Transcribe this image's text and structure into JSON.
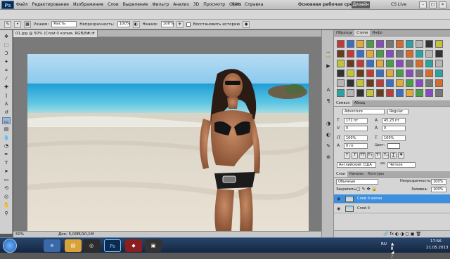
{
  "app": {
    "logo": "Ps",
    "menu": [
      "Файл",
      "Редактирование",
      "Изображение",
      "Слои",
      "Выделение",
      "Фильтр",
      "Анализ",
      "3D",
      "Просмотр",
      "Окно",
      "Справка"
    ],
    "zoom_menu": "50%",
    "workspace": "Основная рабочая среда",
    "design_button": "Дизайн",
    "cslive": "CS Live",
    "window_buttons": [
      "–",
      "□",
      "×"
    ]
  },
  "options": {
    "mode_label": "Режим:",
    "mode_value": "Кисть",
    "opacity_label": "Непрозрачность:",
    "opacity_value": "100%",
    "pressure_label": "Нажим:",
    "pressure_value": "100%",
    "restore_label": "Восстановить историю"
  },
  "document": {
    "tab_title": "01.jpg @ 50% (Слой 0 копия, RGB/8#) *",
    "zoom": "50%",
    "doc_info": "Док: 5,00M/10,1M"
  },
  "panels": {
    "top_tabs": [
      "Образцы",
      "Стили",
      "Инфо"
    ],
    "char_tabs": [
      "Символ",
      "Абзац"
    ],
    "font_family": "Adventure",
    "font_style": "Regular",
    "font_size": "172 пт",
    "leading": "45,23 пт",
    "kerning": "0",
    "tracking": "0",
    "vscale": "100%",
    "hscale": "100%",
    "baseline": "0 пт",
    "color_label": "Цвет:",
    "language": "Английский: США",
    "antialias": "Четкое",
    "format_buttons": [
      "T",
      "T",
      "TT",
      "Tт",
      "T¹",
      "T₁",
      "T",
      "T"
    ],
    "layer_tabs": [
      "Слои",
      "Каналы",
      "Контуры"
    ],
    "blend_mode": "Обычные",
    "opacity_label": "Непрозрачность:",
    "opacity_value": "100%",
    "lock_label": "Закрепить:",
    "fill_label": "Заливка:",
    "fill_value": "100%",
    "layers": [
      "Слой 0 копия",
      "Слой 0"
    ]
  },
  "taskbar": {
    "lang": "RU",
    "time": "17:56",
    "date": "21.05.2013"
  },
  "colors": {
    "selection": "#3d8fe0",
    "taskbar": "#1b3556"
  }
}
